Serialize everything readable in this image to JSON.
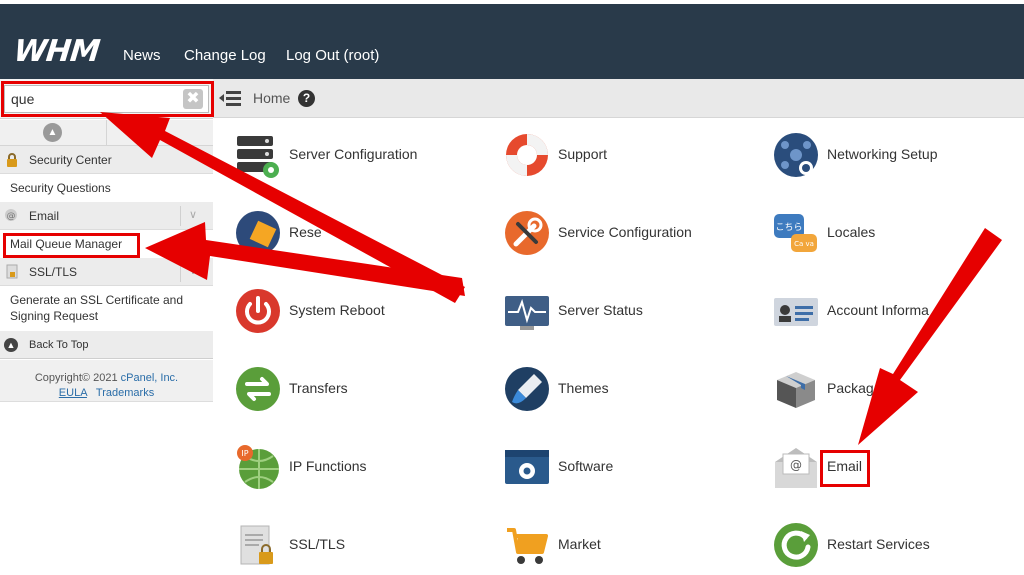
{
  "header": {
    "logo": "WHM",
    "nav": [
      "News",
      "Change Log",
      "Log Out (root)"
    ]
  },
  "sidebar": {
    "search_value": "que",
    "clear_glyph": "✖",
    "categories": [
      {
        "label": "Security Center",
        "icon": "lock-icon",
        "items": [
          "Security Questions"
        ]
      },
      {
        "label": "Email",
        "icon": "email-icon",
        "items": [
          "Mail Queue Manager"
        ]
      },
      {
        "label": "SSL/TLS",
        "icon": "certificate-icon",
        "items": [
          "Generate an SSL Certificate and",
          "Signing Request"
        ]
      }
    ],
    "back_to_top": "Back To Top",
    "footer": {
      "copyright": "Copyright© 2021",
      "company": "cPanel, Inc.",
      "eula": "EULA",
      "trademarks": "Trademarks"
    }
  },
  "breadcrumb": {
    "home": "Home",
    "help": "?"
  },
  "main": {
    "tiles": [
      [
        "Server Configuration",
        "Support",
        "Networking Setup"
      ],
      [
        "Reseller Center",
        "Service Configuration",
        "Locales"
      ],
      [
        "System Reboot",
        "Server Status",
        "Account Information"
      ],
      [
        "Transfers",
        "Themes",
        "Packages"
      ],
      [
        "IP Functions",
        "Software",
        "Email"
      ],
      [
        "SSL/TLS",
        "Market",
        "Restart Services"
      ]
    ],
    "visible_labels": [
      [
        "Server Configuration",
        "Support",
        "Networking Setup"
      ],
      [
        "Rese",
        "Service Configuration",
        "Locales"
      ],
      [
        "System Reboot",
        "Server Status",
        "Account Informa"
      ],
      [
        "Transfers",
        "Themes",
        "Packag"
      ],
      [
        "IP Functions",
        "Software",
        "Email"
      ],
      [
        "SSL/TLS",
        "Market",
        "Restart Services"
      ]
    ]
  },
  "annotation_colors": {
    "arrow": "#e60000",
    "highlight": "#e60000"
  }
}
